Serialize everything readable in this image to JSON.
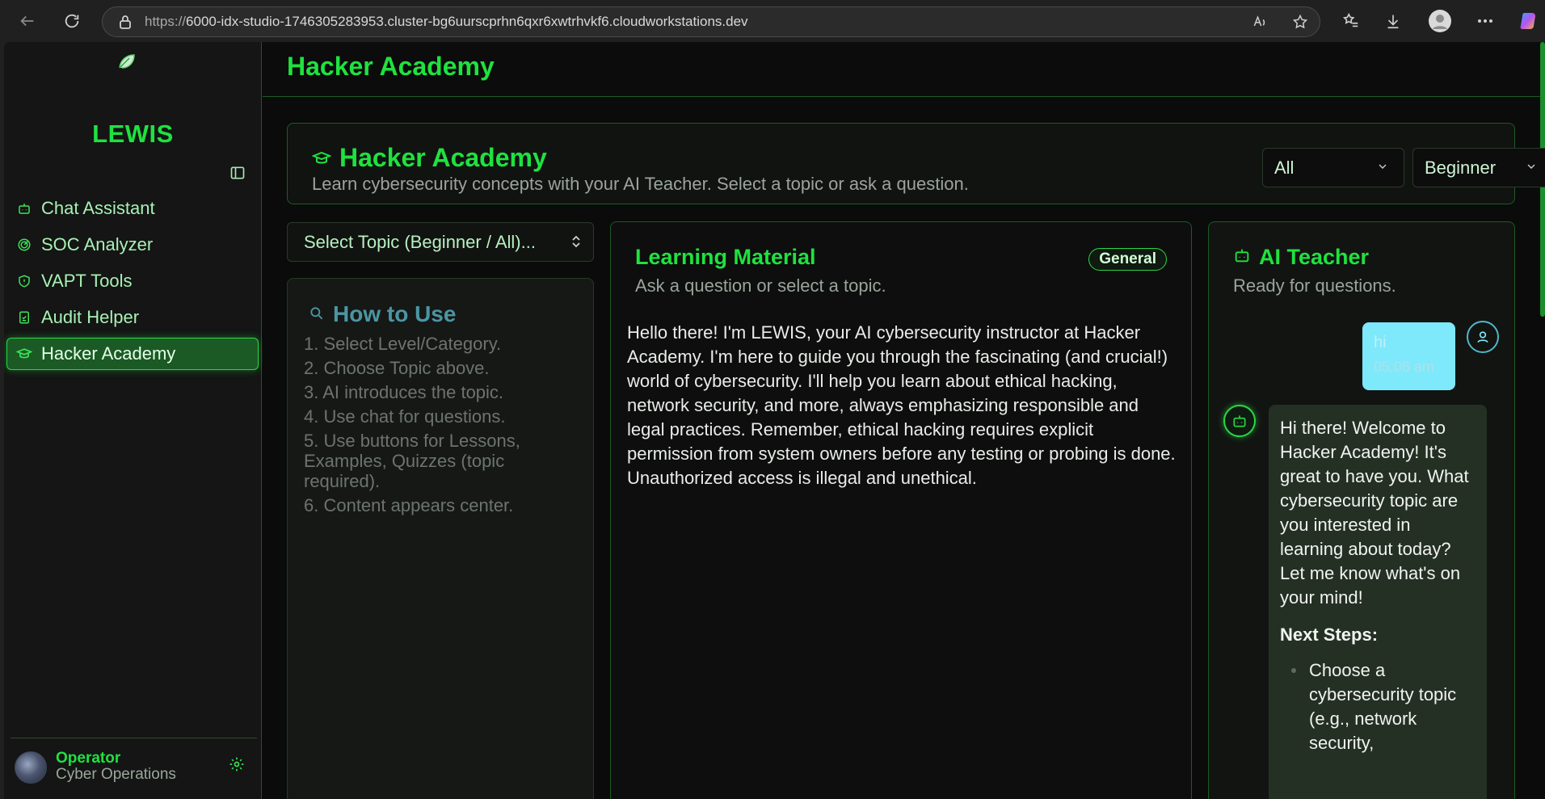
{
  "browser": {
    "url_prefix": "https://",
    "url_rest": "6000-idx-studio-1746305283953.cluster-bg6uurscprhn6qxr6xwtrhvkf6.cloudworkstations.dev"
  },
  "sidebar": {
    "brand": "LEWIS",
    "items": [
      {
        "label": "Chat Assistant",
        "icon": "bot-icon"
      },
      {
        "label": "SOC Analyzer",
        "icon": "radar-icon"
      },
      {
        "label": "VAPT Tools",
        "icon": "shield-icon"
      },
      {
        "label": "Audit Helper",
        "icon": "clipboard-check-icon"
      },
      {
        "label": "Hacker Academy",
        "icon": "graduation-cap-icon",
        "active": true
      }
    ],
    "user": {
      "name": "Operator",
      "role": "Cyber Operations"
    }
  },
  "topbar": {
    "title": "Hacker Academy"
  },
  "header": {
    "title": "Hacker Academy",
    "subtitle": "Learn cybersecurity concepts with your AI Teacher. Select a topic or ask a question.",
    "category_value": "All",
    "level_value": "Beginner"
  },
  "topic_select": {
    "value": "Select Topic (Beginner / All)..."
  },
  "how_to": {
    "title": "How to Use",
    "steps": [
      "1. Select Level/Category.",
      "2. Choose Topic above.",
      "3. AI introduces the topic.",
      "4. Use chat for questions.",
      "5. Use buttons for Lessons, Examples, Quizzes (topic required).",
      "6. Content appears center."
    ]
  },
  "learning": {
    "title": "Learning Material",
    "subtitle": "Ask a question or select a topic.",
    "badge": "General",
    "body": "Hello there! I'm LEWIS, your AI cybersecurity instructor at Hacker Academy. I'm here to guide you through the fascinating (and crucial!) world of cybersecurity. I'll help you learn about ethical hacking, network security, and more, always emphasizing responsible and legal practices. Remember, ethical hacking requires explicit permission from system owners before any testing or probing is done. Unauthorized access is illegal and unethical."
  },
  "teacher": {
    "title": "AI Teacher",
    "subtitle": "Ready for questions.",
    "user_msg": {
      "text": "hi",
      "time": "05:06 am"
    },
    "bot_msg": {
      "text": "Hi there! Welcome to Hacker Academy! It's great to have you. What cybersecurity topic are you interested in learning about today? Let me know what's on your mind!",
      "next_steps_label": "Next Steps:",
      "bullet_1": "Choose a cybersecurity topic (e.g., network security,"
    }
  },
  "colors": {
    "accent": "#1fe23f",
    "background": "#0a0b0a",
    "user_bubble": "#7ee9fb"
  }
}
